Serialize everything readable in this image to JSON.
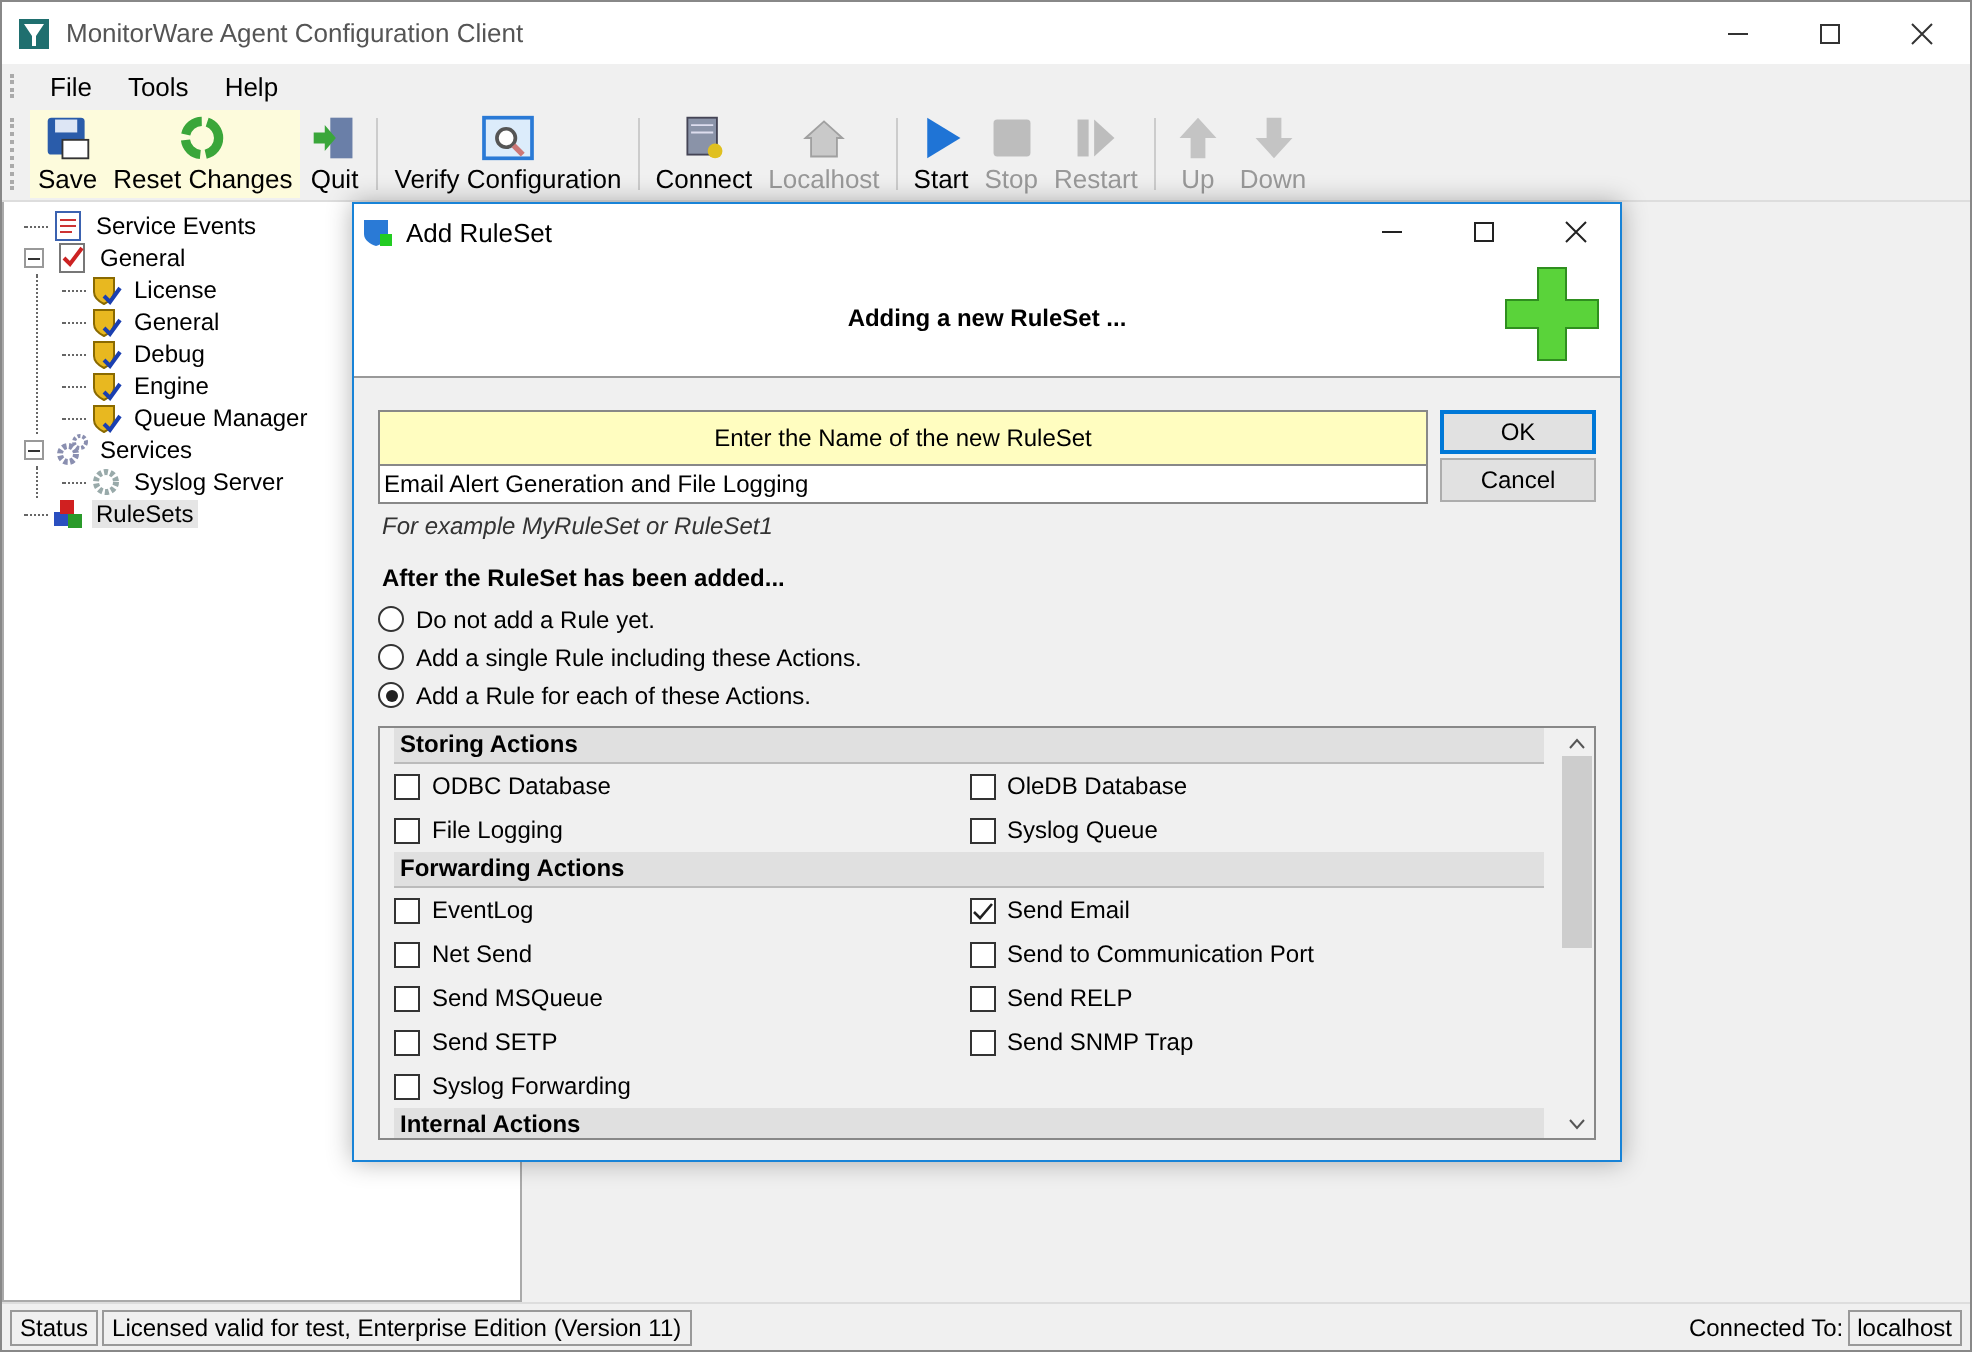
{
  "window": {
    "title": "MonitorWare Agent Configuration Client"
  },
  "menu": [
    "File",
    "Tools",
    "Help"
  ],
  "toolbar": [
    [
      {
        "label": "Save",
        "highlighted": true,
        "disabled": false
      },
      {
        "label": "Reset Changes",
        "highlighted": true,
        "disabled": false
      },
      {
        "label": "Quit",
        "highlighted": false,
        "disabled": false
      }
    ],
    [
      {
        "label": "Verify Configuration",
        "highlighted": false,
        "disabled": false
      }
    ],
    [
      {
        "label": "Connect",
        "highlighted": false,
        "disabled": false
      },
      {
        "label": "Localhost",
        "highlighted": false,
        "disabled": true
      }
    ],
    [
      {
        "label": "Start",
        "highlighted": false,
        "disabled": false
      },
      {
        "label": "Stop",
        "highlighted": false,
        "disabled": true
      },
      {
        "label": "Restart",
        "highlighted": false,
        "disabled": true
      }
    ],
    [
      {
        "label": "Up",
        "highlighted": false,
        "disabled": true
      },
      {
        "label": "Down",
        "highlighted": false,
        "disabled": true
      }
    ]
  ],
  "tree": [
    {
      "label": "Service Events",
      "kind": "events",
      "selected": false
    },
    {
      "label": "General",
      "kind": "settings",
      "selected": false,
      "expanded": true,
      "children": [
        {
          "label": "License",
          "kind": "module",
          "selected": false
        },
        {
          "label": "General",
          "kind": "module",
          "selected": false
        },
        {
          "label": "Debug",
          "kind": "module",
          "selected": false
        },
        {
          "label": "Engine",
          "kind": "module",
          "selected": false
        },
        {
          "label": "Queue Manager",
          "kind": "module",
          "selected": false
        }
      ]
    },
    {
      "label": "Services",
      "kind": "services",
      "selected": false,
      "expanded": true,
      "children": [
        {
          "label": "Syslog Server",
          "kind": "service",
          "selected": false
        }
      ]
    },
    {
      "label": "RuleSets",
      "kind": "rulesets",
      "selected": true
    }
  ],
  "dialog": {
    "title": "Add RuleSet",
    "heading": "Adding a new RuleSet ...",
    "name_prompt": "Enter the Name of the new RuleSet",
    "name_value": "Email Alert Generation and File Logging",
    "hint": "For example MyRuleSet or RuleSet1",
    "ok": "OK",
    "cancel": "Cancel",
    "options_title": "After the RuleSet has been added...",
    "options": [
      {
        "label": "Do not add a Rule yet.",
        "selected": false
      },
      {
        "label": "Add a single Rule including these Actions.",
        "selected": false
      },
      {
        "label": "Add a Rule for each of these Actions.",
        "selected": true
      }
    ],
    "action_groups": [
      {
        "title": "Storing Actions",
        "items": [
          {
            "label": "ODBC Database",
            "checked": false
          },
          {
            "label": "OleDB Database",
            "checked": false
          },
          {
            "label": "File Logging",
            "checked": false
          },
          {
            "label": "Syslog Queue",
            "checked": false
          }
        ]
      },
      {
        "title": "Forwarding Actions",
        "items": [
          {
            "label": "EventLog",
            "checked": false
          },
          {
            "label": "Send Email",
            "checked": true
          },
          {
            "label": "Net Send",
            "checked": false
          },
          {
            "label": "Send to Communication Port",
            "checked": false
          },
          {
            "label": "Send MSQueue",
            "checked": false
          },
          {
            "label": "Send RELP",
            "checked": false
          },
          {
            "label": "Send SETP",
            "checked": false
          },
          {
            "label": "Send SNMP Trap",
            "checked": false
          },
          {
            "label": "Syslog Forwarding",
            "checked": false
          }
        ]
      },
      {
        "title": "Internal Actions"
      }
    ]
  },
  "status_bar": {
    "status": "Status",
    "license": "Licensed valid for test, Enterprise Edition (Version 11)",
    "connected_label": "Connected To:",
    "connected_value": "localhost"
  }
}
